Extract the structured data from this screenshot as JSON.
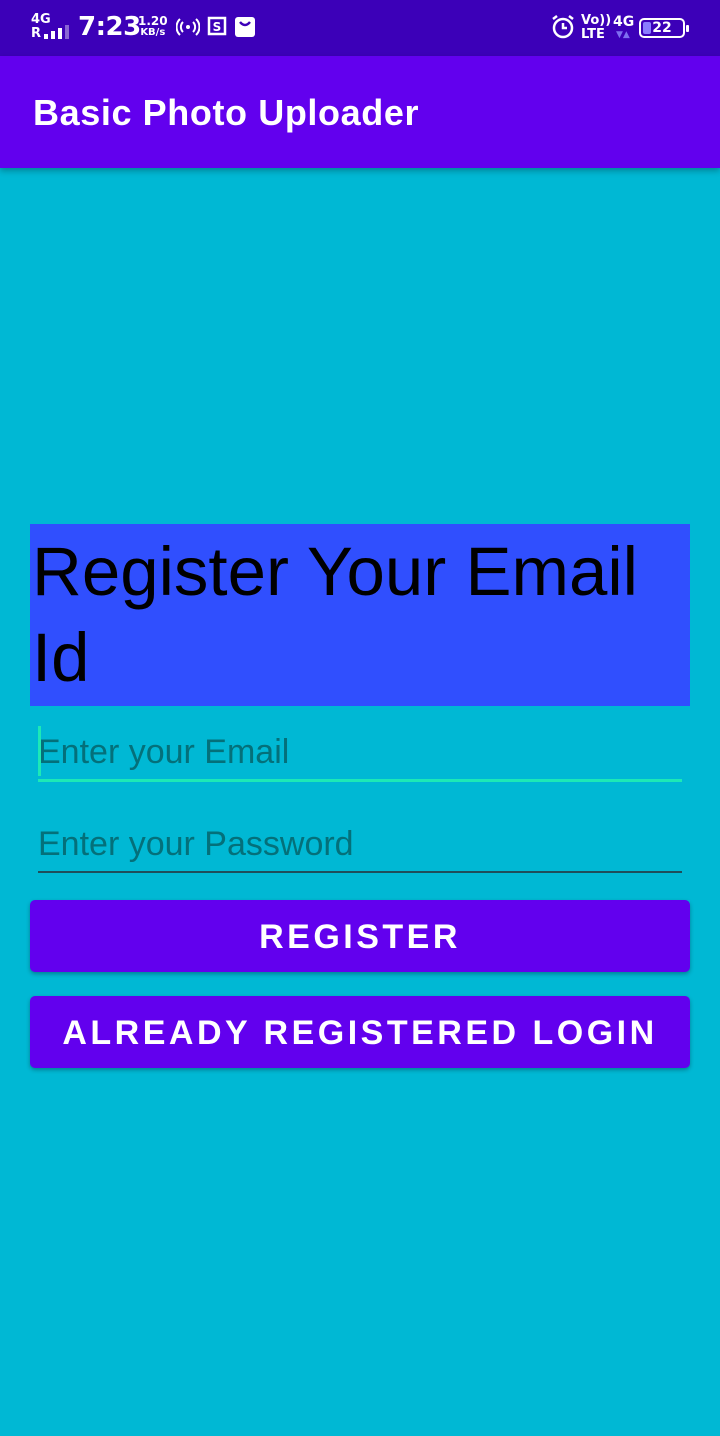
{
  "status_bar": {
    "network_type": "4G",
    "network_sub": "R",
    "time": "7:23",
    "speed_value": "1.20",
    "speed_unit": "KB/s",
    "volte_top": "Vo))",
    "volte_bottom": "LTE",
    "data_type": "4G",
    "battery_level": "22",
    "icons": [
      "hotspot-icon",
      "screenshot-icon",
      "shopping-bag-icon",
      "alarm-icon"
    ]
  },
  "app_bar": {
    "title": "Basic Photo Uploader",
    "color": "#6200ee"
  },
  "form": {
    "heading": "Register Your Email Id",
    "email_placeholder": "Enter your Email",
    "email_value": "",
    "password_placeholder": "Enter your Password",
    "password_value": "",
    "register_label": "REGISTER",
    "login_label": "ALREADY REGISTERED LOGIN"
  },
  "colors": {
    "background": "#00b8d4",
    "heading_background": "#304ffe",
    "accent": "#1de9b6",
    "status_bar": "#3c00b8"
  }
}
